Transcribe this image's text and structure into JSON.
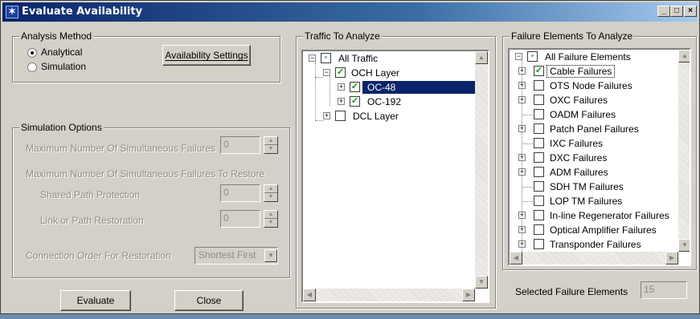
{
  "window": {
    "title": "Evaluate Availability",
    "minimize": "_",
    "maximize": "□",
    "close": "×"
  },
  "analysis": {
    "title": "Analysis Method",
    "options": [
      {
        "label": "Analytical",
        "selected": true
      },
      {
        "label": "Simulation",
        "selected": false
      }
    ],
    "settings_button": "Availability Settings",
    "settings_underline": "A"
  },
  "simulation": {
    "title": "Simulation Options",
    "max_failures_label": "Maximum Number Of Simultaneous Failures",
    "max_failures_value": "0",
    "max_restore_label": "Maximum Number Of Simultaneous Failures To Restore",
    "shared_label": "Shared Path Protection",
    "shared_value": "0",
    "link_label": "Link or Path Restoration",
    "link_value": "0",
    "order_label": "Connection Order For Restoration",
    "order_value": "Shortest First"
  },
  "buttons": {
    "evaluate": "Evaluate",
    "close": "Close"
  },
  "traffic": {
    "title": "Traffic To Analyze",
    "items": [
      {
        "label": "All Traffic",
        "level": 0,
        "expander": "−",
        "check": "partial"
      },
      {
        "label": "OCH Layer",
        "level": 1,
        "expander": "−",
        "check": "checked"
      },
      {
        "label": "OC-48",
        "level": 2,
        "expander": "+",
        "check": "checked",
        "selected": true
      },
      {
        "label": "OC-192",
        "level": 2,
        "expander": "+",
        "check": "checked"
      },
      {
        "label": "DCL Layer",
        "level": 1,
        "expander": "+",
        "check": "unchecked"
      }
    ]
  },
  "failures": {
    "title": "Failure Elements To Analyze",
    "root": "All Failure Elements",
    "items": [
      {
        "label": "Cable Failures",
        "expander": "+",
        "check": "checked",
        "focused": true
      },
      {
        "label": "OTS Node Failures",
        "expander": "+",
        "check": "unchecked"
      },
      {
        "label": "OXC Failures",
        "expander": "+",
        "check": "unchecked"
      },
      {
        "label": "OADM Failures",
        "expander": "",
        "check": "unchecked"
      },
      {
        "label": "Patch Panel Failures",
        "expander": "+",
        "check": "unchecked"
      },
      {
        "label": "IXC Failures",
        "expander": "",
        "check": "unchecked"
      },
      {
        "label": "DXC Failures",
        "expander": "+",
        "check": "unchecked"
      },
      {
        "label": "ADM Failures",
        "expander": "+",
        "check": "unchecked"
      },
      {
        "label": "SDH TM Failures",
        "expander": "",
        "check": "unchecked"
      },
      {
        "label": "LOP TM Failures",
        "expander": "",
        "check": "unchecked"
      },
      {
        "label": "In-line Regenerator Failures",
        "expander": "+",
        "check": "unchecked"
      },
      {
        "label": "Optical Amplifier Failures",
        "expander": "+",
        "check": "unchecked"
      },
      {
        "label": "Transponder Failures",
        "expander": "+",
        "check": "unchecked"
      }
    ],
    "selected_label": "Selected Failure Elements",
    "selected_value": "15"
  },
  "icons": {
    "up": "▲",
    "down": "▼",
    "left": "◀",
    "right": "▶",
    "check": "✓",
    "plus": "+",
    "minus": "−"
  },
  "colors": {
    "title_start": "#0a246a",
    "title_end": "#a6caf0",
    "check": "#109010",
    "selection": "#0a246a",
    "face": "#d4d0c8"
  }
}
